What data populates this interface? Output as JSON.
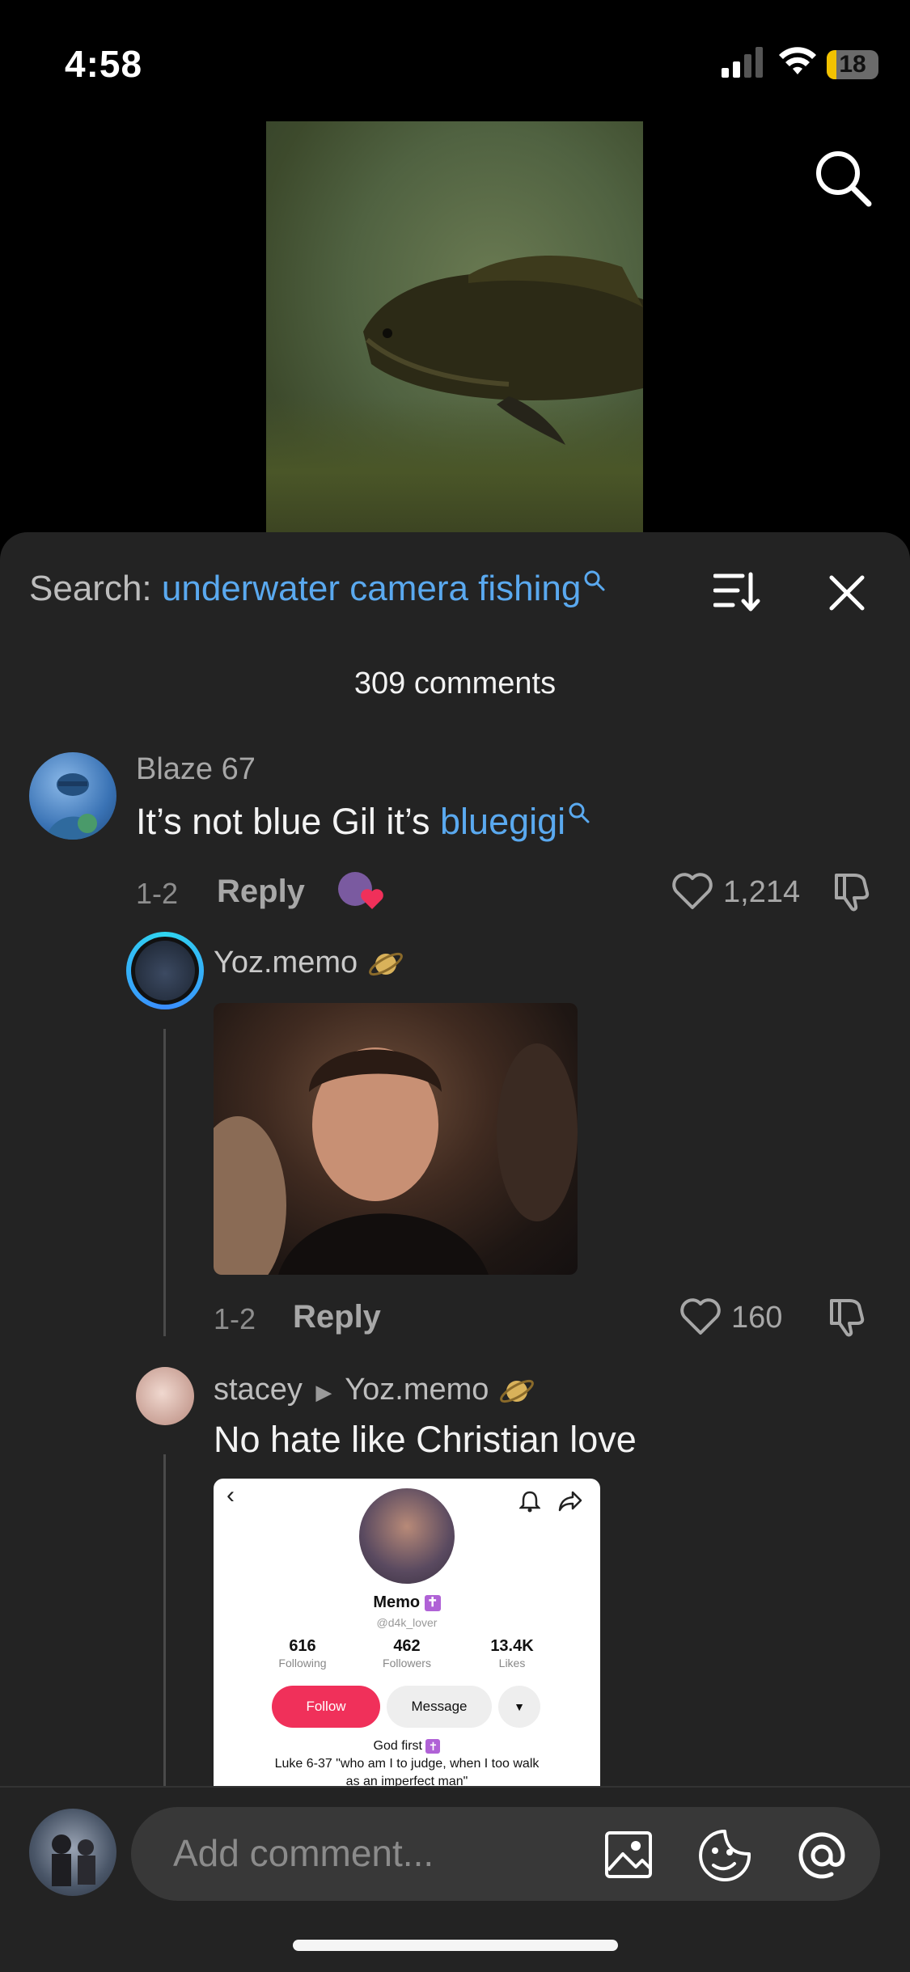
{
  "status": {
    "time": "4:58",
    "battery": "18"
  },
  "comments_sheet": {
    "search_prefix": "Search:",
    "search_query": "underwater camera fishing",
    "comment_count": "309 comments"
  },
  "comments": [
    {
      "user": "Blaze 67",
      "text_before": "It’s not blue Gil it’s ",
      "text_link": "bluegigi",
      "date": "1-2",
      "reply_label": "Reply",
      "likes": "1,214"
    },
    {
      "user": "Yoz.memo",
      "date": "1-2",
      "reply_label": "Reply",
      "likes": "160"
    },
    {
      "user": "stacey",
      "reply_to": "Yoz.memo",
      "text": "No hate like Christian love"
    }
  ],
  "embedded_profile": {
    "name": "Memo",
    "handle": "@d4k_lover",
    "stats": [
      {
        "value": "616",
        "label": "Following"
      },
      {
        "value": "462",
        "label": "Followers"
      },
      {
        "value": "13.4K",
        "label": "Likes"
      }
    ],
    "follow_label": "Follow",
    "message_label": "Message",
    "bio_line1": "God first",
    "bio_line2": "Luke 6-37 \"who am I to judge, when I too walk",
    "bio_line3": "as an imperfect man\""
  },
  "composer": {
    "placeholder": "Add comment..."
  },
  "colors": {
    "link": "#5aa9ef",
    "sheet": "#232323",
    "follow": "#f0305a"
  }
}
